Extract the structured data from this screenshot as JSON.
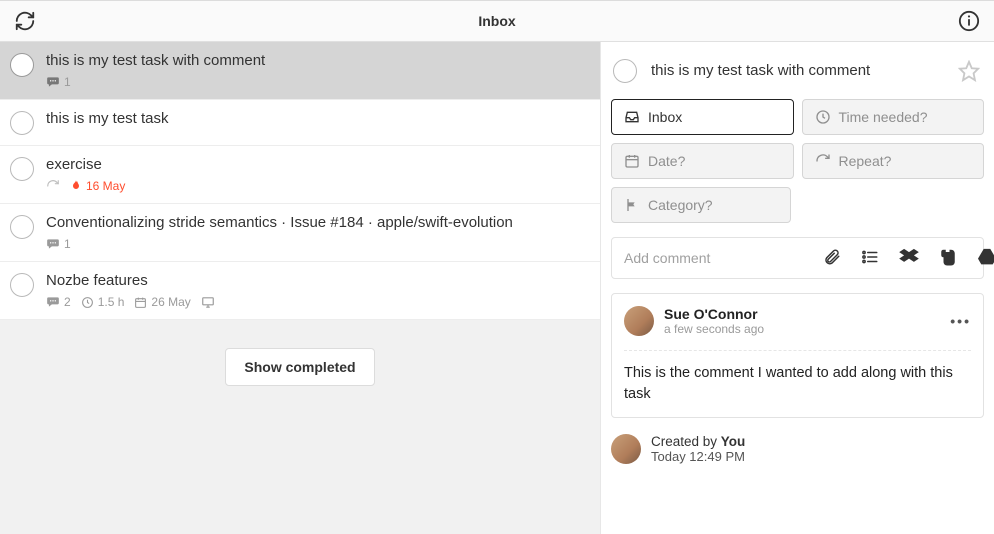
{
  "header": {
    "title": "Inbox"
  },
  "tasks": [
    {
      "title": "this is my test task with comment",
      "selected": true,
      "meta": {
        "comments": "1"
      }
    },
    {
      "title": "this is my test task",
      "selected": false,
      "meta": {}
    },
    {
      "title": "exercise",
      "selected": false,
      "meta": {
        "recurring": true,
        "due": "16 May"
      }
    },
    {
      "title": "Conventionalizing stride semantics · Issue #184 · apple/swift-evolution",
      "selected": false,
      "meta": {
        "comments": "1"
      }
    },
    {
      "title": "Nozbe features",
      "selected": false,
      "meta": {
        "comments": "2",
        "time": "1.5 h",
        "date": "26 May",
        "display": true
      }
    }
  ],
  "show_completed_label": "Show completed",
  "detail": {
    "title": "this is my test task with comment",
    "props": {
      "inbox": "Inbox",
      "time": "Time needed?",
      "date": "Date?",
      "repeat": "Repeat?",
      "category": "Category?"
    },
    "comment_placeholder": "Add comment",
    "comment": {
      "author": "Sue O'Connor",
      "when": "a few seconds ago",
      "body": "This is the comment I wanted to add along with this task"
    },
    "created": {
      "prefix": "Created by ",
      "by": "You",
      "when": "Today 12:49 PM"
    }
  }
}
